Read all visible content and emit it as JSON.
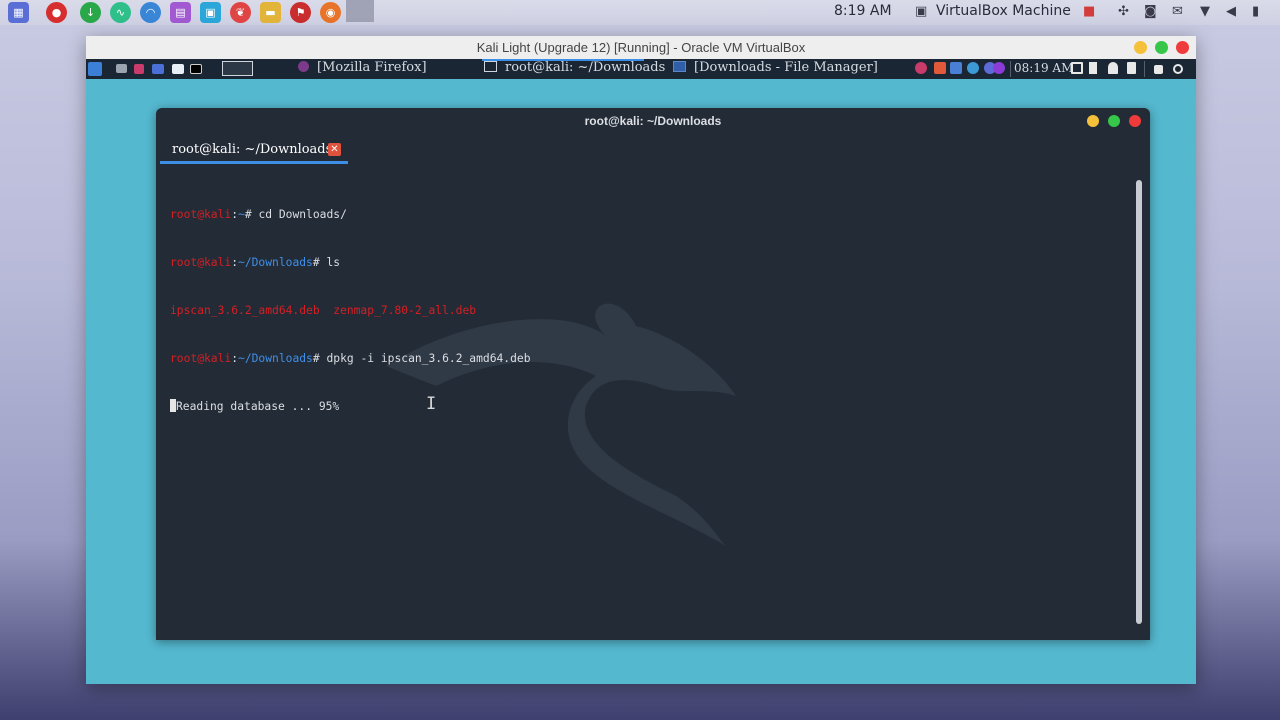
{
  "host": {
    "dock_icons": [
      {
        "name": "apps-grid-icon",
        "color": "#5a6fd6"
      },
      {
        "name": "red-circle-icon",
        "color": "#d62e2e"
      },
      {
        "name": "download-icon",
        "color": "#29a84a"
      },
      {
        "name": "activity-monitor-icon",
        "color": "#2fbf8a"
      },
      {
        "name": "network-icon",
        "color": "#3a86d6"
      },
      {
        "name": "notes-icon",
        "color": "#a15ad1"
      },
      {
        "name": "photo-icon",
        "color": "#2aa7d8"
      },
      {
        "name": "cherry-icon",
        "color": "#e04545"
      },
      {
        "name": "folder-icon",
        "color": "#e2b53a"
      },
      {
        "name": "antivirus-icon",
        "color": "#c92d2d"
      },
      {
        "name": "firefox-icon",
        "color": "#e8742a"
      },
      {
        "name": "window-thumbnail-icon",
        "color": "#9fa3b5"
      }
    ],
    "clock": "8:19 AM",
    "vbox_label": "VirtualBox Machine",
    "tray_icons": [
      "record-icon",
      "slack-icon",
      "camera-icon",
      "message-icon",
      "wifi-icon",
      "volume-icon",
      "battery-icon"
    ]
  },
  "vbox": {
    "title": "Kali Light (Upgrade 12) [Running] - Oracle VM VirtualBox",
    "button_colors": {
      "minimize": "#f5c03a",
      "maximize": "#35c64a",
      "close": "#ef3b3b"
    }
  },
  "guest_panel": {
    "tasks": [
      {
        "label": "[Mozilla Firefox]",
        "active": false
      },
      {
        "label": "root@kali: ~/Downloads",
        "active": true
      },
      {
        "label": "[Downloads - File Manager]",
        "active": false
      }
    ],
    "clock": "08:19 AM"
  },
  "terminal": {
    "title": "root@kali: ~/Downloads",
    "tab_label": "root@kali: ~/Downloads",
    "tab_close_icon": "✕",
    "lines": [
      {
        "user": "root@kali",
        "sep": ":",
        "path": "~",
        "hash": "# ",
        "cmd": "cd Downloads/"
      },
      {
        "user": "root@kali",
        "sep": ":",
        "path": "~/Downloads",
        "hash": "# ",
        "cmd": "ls"
      },
      {
        "files": "ipscan_3.6.2_amd64.deb  zenmap_7.80-2_all.deb"
      },
      {
        "user": "root@kali",
        "sep": ":",
        "path": "~/Downloads",
        "hash": "# ",
        "cmd": "dpkg -i ipscan_3.6.2_amd64.deb"
      },
      {
        "output": "Reading database ... 95%"
      }
    ],
    "cursor_glyph": "I"
  }
}
